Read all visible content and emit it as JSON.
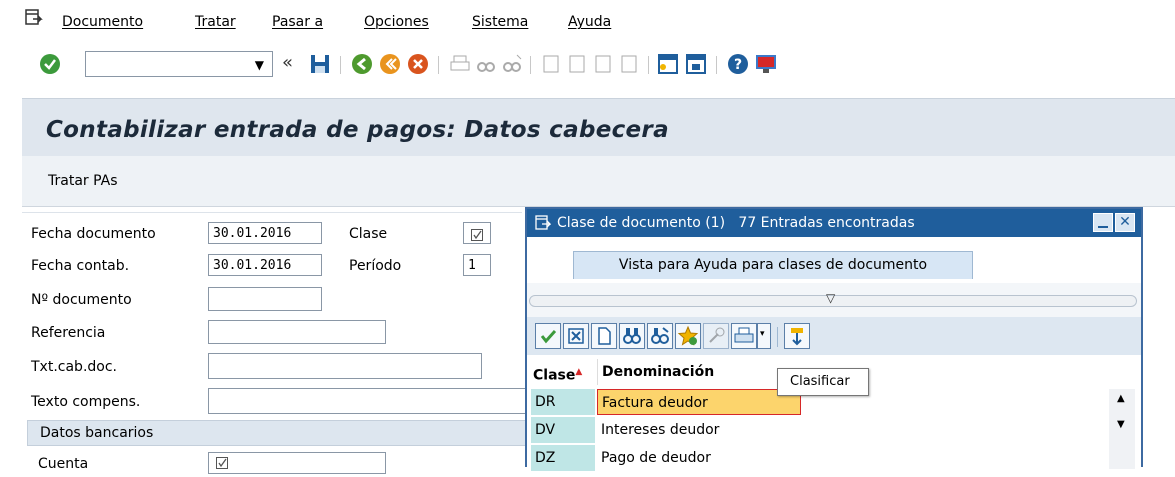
{
  "menu": {
    "items": [
      "Documento",
      "Tratar",
      "Pasar a",
      "Opciones",
      "Sistema",
      "Ayuda"
    ]
  },
  "toolbar": {
    "command_value": "",
    "colors": {
      "ok": "#3c9a3c",
      "save": "#1f5e9c"
    }
  },
  "screen": {
    "title": "Contabilizar entrada de pagos: Datos cabecera",
    "app_button": "Tratar PAs"
  },
  "form": {
    "fecha_documento": {
      "label": "Fecha documento",
      "value": "30.01.2016"
    },
    "fecha_contab": {
      "label": "Fecha contab.",
      "value": "30.01.2016"
    },
    "no_documento": {
      "label": "Nº documento",
      "value": ""
    },
    "referencia": {
      "label": "Referencia",
      "value": ""
    },
    "txt_cab_doc": {
      "label": "Txt.cab.doc.",
      "value": ""
    },
    "texto_compens": {
      "label": "Texto compens.",
      "value": ""
    },
    "clase": {
      "label": "Clase",
      "value": ""
    },
    "periodo": {
      "label": "Período",
      "value": "1"
    },
    "section_bancarios": "Datos bancarios",
    "cuenta_label": "Cuenta"
  },
  "dialog": {
    "title": "Clase de documento (1)",
    "count": "77 Entradas encontradas",
    "tab": "Vista para Ayuda para clases de documento",
    "tooltip": "Clasificar",
    "columns": [
      "Clase",
      "Denominación"
    ],
    "rows": [
      {
        "clase": "DR",
        "denominacion": "Factura deudor"
      },
      {
        "clase": "DV",
        "denominacion": "Intereses deudor"
      },
      {
        "clase": "DZ",
        "denominacion": "Pago de deudor"
      }
    ]
  }
}
